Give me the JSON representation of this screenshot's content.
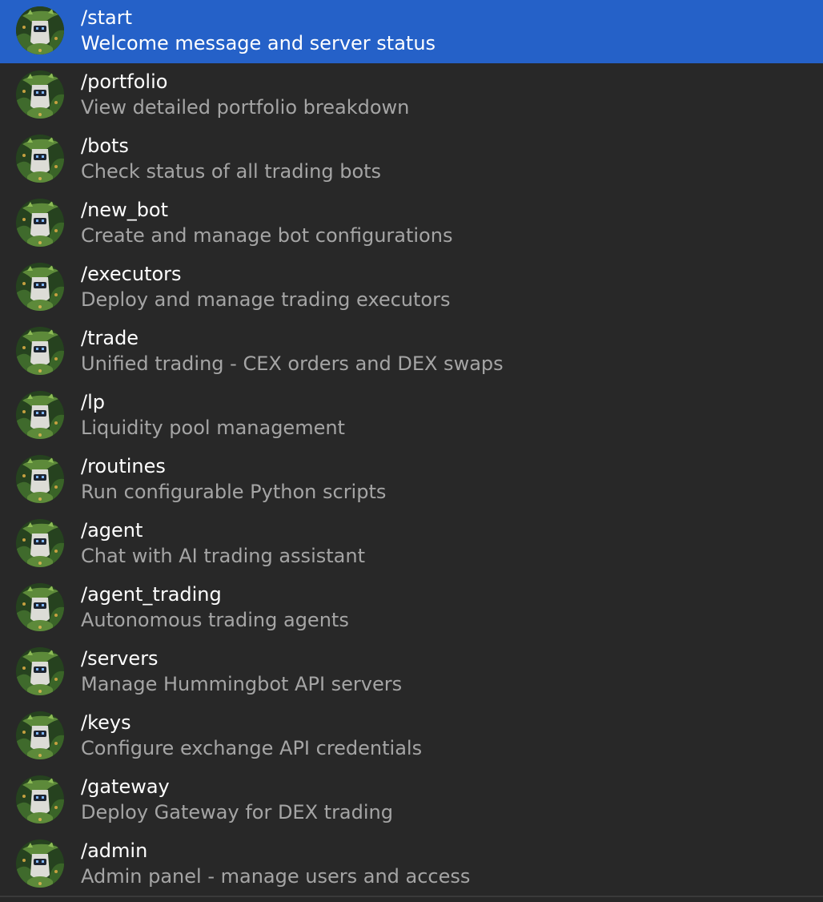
{
  "colors": {
    "background": "#282828",
    "selected_background": "#2561c8",
    "command_text": "#ffffff",
    "description_text": "#a5a5a5"
  },
  "selected_index": 0,
  "commands": [
    {
      "command": "/start",
      "description": "Welcome message and server status",
      "icon": "bot-avatar-icon"
    },
    {
      "command": "/portfolio",
      "description": "View detailed portfolio breakdown",
      "icon": "bot-avatar-icon"
    },
    {
      "command": "/bots",
      "description": "Check status of all trading bots",
      "icon": "bot-avatar-icon"
    },
    {
      "command": "/new_bot",
      "description": "Create and manage bot configurations",
      "icon": "bot-avatar-icon"
    },
    {
      "command": "/executors",
      "description": "Deploy and manage trading executors",
      "icon": "bot-avatar-icon"
    },
    {
      "command": "/trade",
      "description": "Unified trading - CEX orders and DEX swaps",
      "icon": "bot-avatar-icon"
    },
    {
      "command": "/lp",
      "description": "Liquidity pool management",
      "icon": "bot-avatar-icon"
    },
    {
      "command": "/routines",
      "description": "Run configurable Python scripts",
      "icon": "bot-avatar-icon"
    },
    {
      "command": "/agent",
      "description": "Chat with AI trading assistant",
      "icon": "bot-avatar-icon"
    },
    {
      "command": "/agent_trading",
      "description": "Autonomous trading agents",
      "icon": "bot-avatar-icon"
    },
    {
      "command": "/servers",
      "description": "Manage Hummingbot API servers",
      "icon": "bot-avatar-icon"
    },
    {
      "command": "/keys",
      "description": "Configure exchange API credentials",
      "icon": "bot-avatar-icon"
    },
    {
      "command": "/gateway",
      "description": "Deploy Gateway for DEX trading",
      "icon": "bot-avatar-icon"
    },
    {
      "command": "/admin",
      "description": "Admin panel - manage users and access",
      "icon": "bot-avatar-icon"
    }
  ]
}
